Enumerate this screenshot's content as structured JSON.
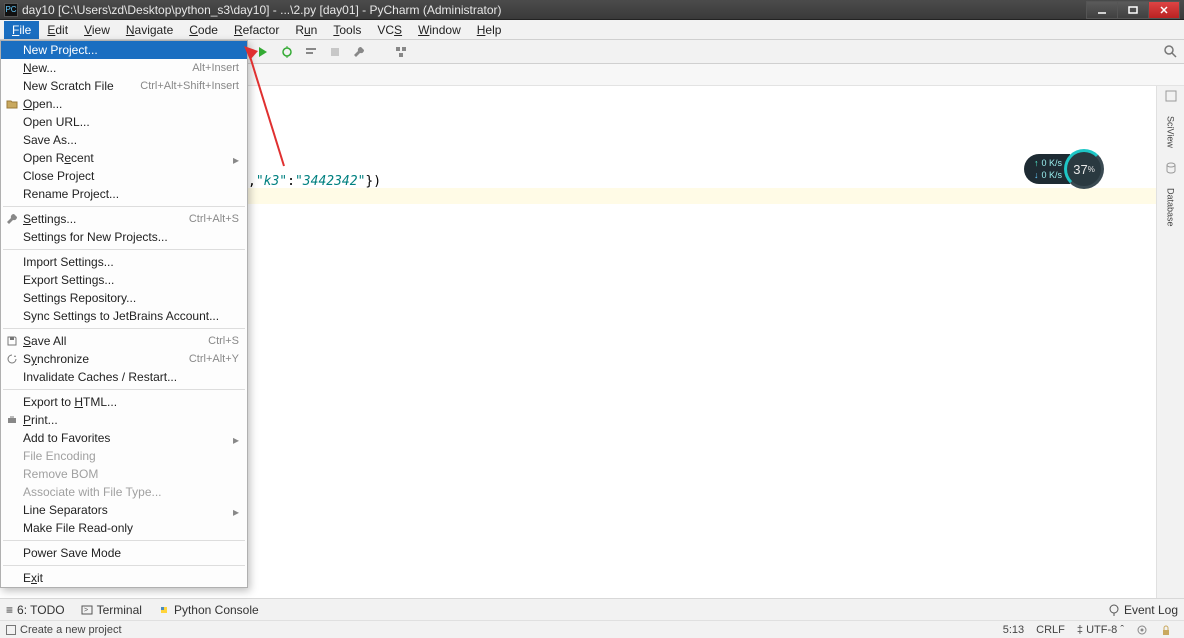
{
  "window": {
    "title": "day10 [C:\\Users\\zd\\Desktop\\python_s3\\day10] - ...\\2.py [day01] - PyCharm (Administrator)"
  },
  "menubar": [
    "File",
    "Edit",
    "View",
    "Navigate",
    "Code",
    "Refactor",
    "Run",
    "Tools",
    "VCS",
    "Window",
    "Help"
  ],
  "file_menu": {
    "groups": [
      [
        {
          "label": "New Project...",
          "selected": true
        },
        {
          "label": "New...",
          "shortcut": "Alt+Insert"
        },
        {
          "label": "New Scratch File",
          "shortcut": "Ctrl+Alt+Shift+Insert"
        },
        {
          "label": "Open...",
          "icon": "folder-open-icon"
        },
        {
          "label": "Open URL..."
        },
        {
          "label": "Save As..."
        },
        {
          "label": "Open Recent",
          "submenu": true
        },
        {
          "label": "Close Project"
        },
        {
          "label": "Rename Project..."
        }
      ],
      [
        {
          "label": "Settings...",
          "shortcut": "Ctrl+Alt+S",
          "icon": "wrench-icon"
        },
        {
          "label": "Settings for New Projects..."
        }
      ],
      [
        {
          "label": "Import Settings..."
        },
        {
          "label": "Export Settings..."
        },
        {
          "label": "Settings Repository..."
        },
        {
          "label": "Sync Settings to JetBrains Account..."
        }
      ],
      [
        {
          "label": "Save All",
          "shortcut": "Ctrl+S",
          "icon": "save-icon"
        },
        {
          "label": "Synchronize",
          "shortcut": "Ctrl+Alt+Y",
          "icon": "sync-icon"
        },
        {
          "label": "Invalidate Caches / Restart..."
        }
      ],
      [
        {
          "label": "Export to HTML..."
        },
        {
          "label": "Print...",
          "icon": "print-icon"
        },
        {
          "label": "Add to Favorites",
          "submenu": true
        },
        {
          "label": "File Encoding",
          "disabled": true
        },
        {
          "label": "Remove BOM",
          "disabled": true
        },
        {
          "label": "Associate with File Type...",
          "disabled": true
        },
        {
          "label": "Line Separators",
          "submenu": true
        },
        {
          "label": "Make File Read-only"
        }
      ],
      [
        {
          "label": "Power Save Mode"
        }
      ],
      [
        {
          "label": "Exit"
        }
      ]
    ]
  },
  "editor": {
    "code_fragment_prefix": ",",
    "code_fragment_k": "\"k3\"",
    "code_fragment_colon": ":",
    "code_fragment_v": "\"3442342\"",
    "code_fragment_suffix": "})"
  },
  "right_tools": [
    "SciView",
    "Database"
  ],
  "net_widget": {
    "up": "0 K/s",
    "down": "0 K/s",
    "percent": "37",
    "unit": "%"
  },
  "bottom_tools": {
    "todo": "6: TODO",
    "terminal": "Terminal",
    "pyconsole": "Python Console",
    "eventlog": "Event Log"
  },
  "statusbar": {
    "hint": "Create a new project",
    "pos": "5:13",
    "linesep": "CRLF",
    "encoding": "UTF-8"
  }
}
